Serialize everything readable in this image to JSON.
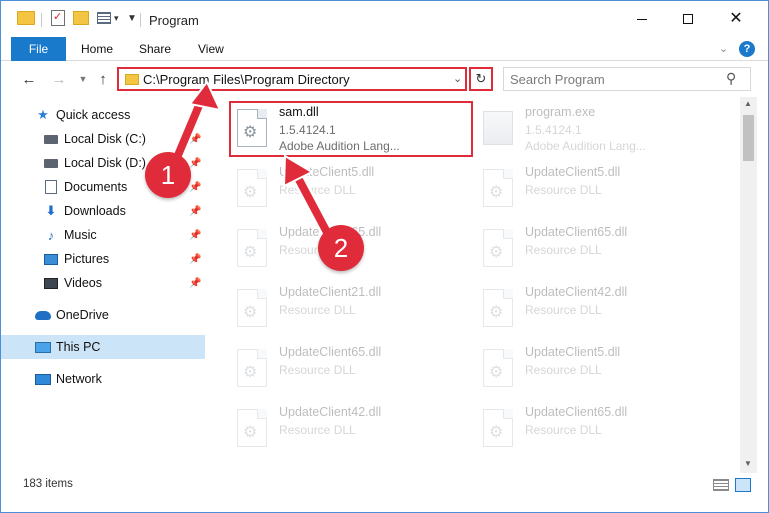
{
  "window": {
    "title": "Program",
    "controls": {
      "minimize": "minimize",
      "maximize": "maximize",
      "close": "✕"
    }
  },
  "ribbon": {
    "tabs": [
      {
        "label": "File",
        "active": true
      },
      {
        "label": "Home"
      },
      {
        "label": "Share"
      },
      {
        "label": "View"
      }
    ],
    "help_label": "?"
  },
  "navigation": {
    "back": "←",
    "forward": "→",
    "recent": "⌄",
    "up": "↑",
    "address": "C:\\Program Files\\Program Directory",
    "refresh": "↻",
    "search_placeholder": "Search Program"
  },
  "sidebar": {
    "items": [
      {
        "label": "Quick access",
        "icon": "star-icon",
        "pinned": false
      },
      {
        "label": "Local Disk (C:)",
        "icon": "drive-icon",
        "pinned": true
      },
      {
        "label": "Local Disk (D:)",
        "icon": "drive-icon",
        "pinned": true
      },
      {
        "label": "Documents",
        "icon": "documents-icon",
        "pinned": true
      },
      {
        "label": "Downloads",
        "icon": "download-arrow-icon",
        "pinned": true
      },
      {
        "label": "Music",
        "icon": "music-note-icon",
        "pinned": true
      },
      {
        "label": "Pictures",
        "icon": "pictures-icon",
        "pinned": true
      },
      {
        "label": "Videos",
        "icon": "videos-icon",
        "pinned": true
      },
      {
        "label": "OneDrive",
        "icon": "cloud-icon",
        "pinned": false
      },
      {
        "label": "This PC",
        "icon": "computer-icon",
        "pinned": false,
        "selected": true
      },
      {
        "label": "Network",
        "icon": "network-icon",
        "pinned": false
      }
    ]
  },
  "files": [
    {
      "name": "sam.dll",
      "line2": "1.5.4124.1",
      "line3": "Adobe Audition Lang...",
      "icon": "dll-file-icon",
      "highlighted": true
    },
    {
      "name": "program.exe",
      "line2": "1.5.4124.1",
      "line3": "Adobe Audition Lang...",
      "icon": "exe-file-icon",
      "faded": true
    },
    {
      "name": "UpdateClient5.dll",
      "line2": "Resource DLL",
      "icon": "dll-file-icon",
      "faded": true
    },
    {
      "name": "UpdateClient5.dll",
      "line2": "Resource DLL",
      "icon": "dll-file-icon",
      "faded": true
    },
    {
      "name": "UpdateClient65.dll",
      "line2": "Resource DLL",
      "icon": "dll-file-icon",
      "faded": true
    },
    {
      "name": "UpdateClient65.dll",
      "line2": "Resource DLL",
      "icon": "dll-file-icon",
      "faded": true
    },
    {
      "name": "UpdateClient21.dll",
      "line2": "Resource DLL",
      "icon": "dll-file-icon",
      "faded": true
    },
    {
      "name": "UpdateClient42.dll",
      "line2": "Resource DLL",
      "icon": "dll-file-icon",
      "faded": true
    },
    {
      "name": "UpdateClient65.dll",
      "line2": "Resource DLL",
      "icon": "dll-file-icon",
      "faded": true
    },
    {
      "name": "UpdateClient5.dll",
      "line2": "Resource DLL",
      "icon": "dll-file-icon",
      "faded": true
    },
    {
      "name": "UpdateClient42.dll",
      "line2": "Resource DLL",
      "icon": "dll-file-icon",
      "faded": true
    },
    {
      "name": "UpdateClient65.dll",
      "line2": "Resource DLL",
      "icon": "dll-file-icon",
      "faded": true
    }
  ],
  "status": {
    "item_count": "183 items"
  },
  "annotations": {
    "badge1": "1",
    "badge2": "2",
    "color": "#e02b3a"
  },
  "colors": {
    "accent": "#1979ca",
    "selection": "#cce4f7",
    "highlight": "#e02b3a"
  }
}
